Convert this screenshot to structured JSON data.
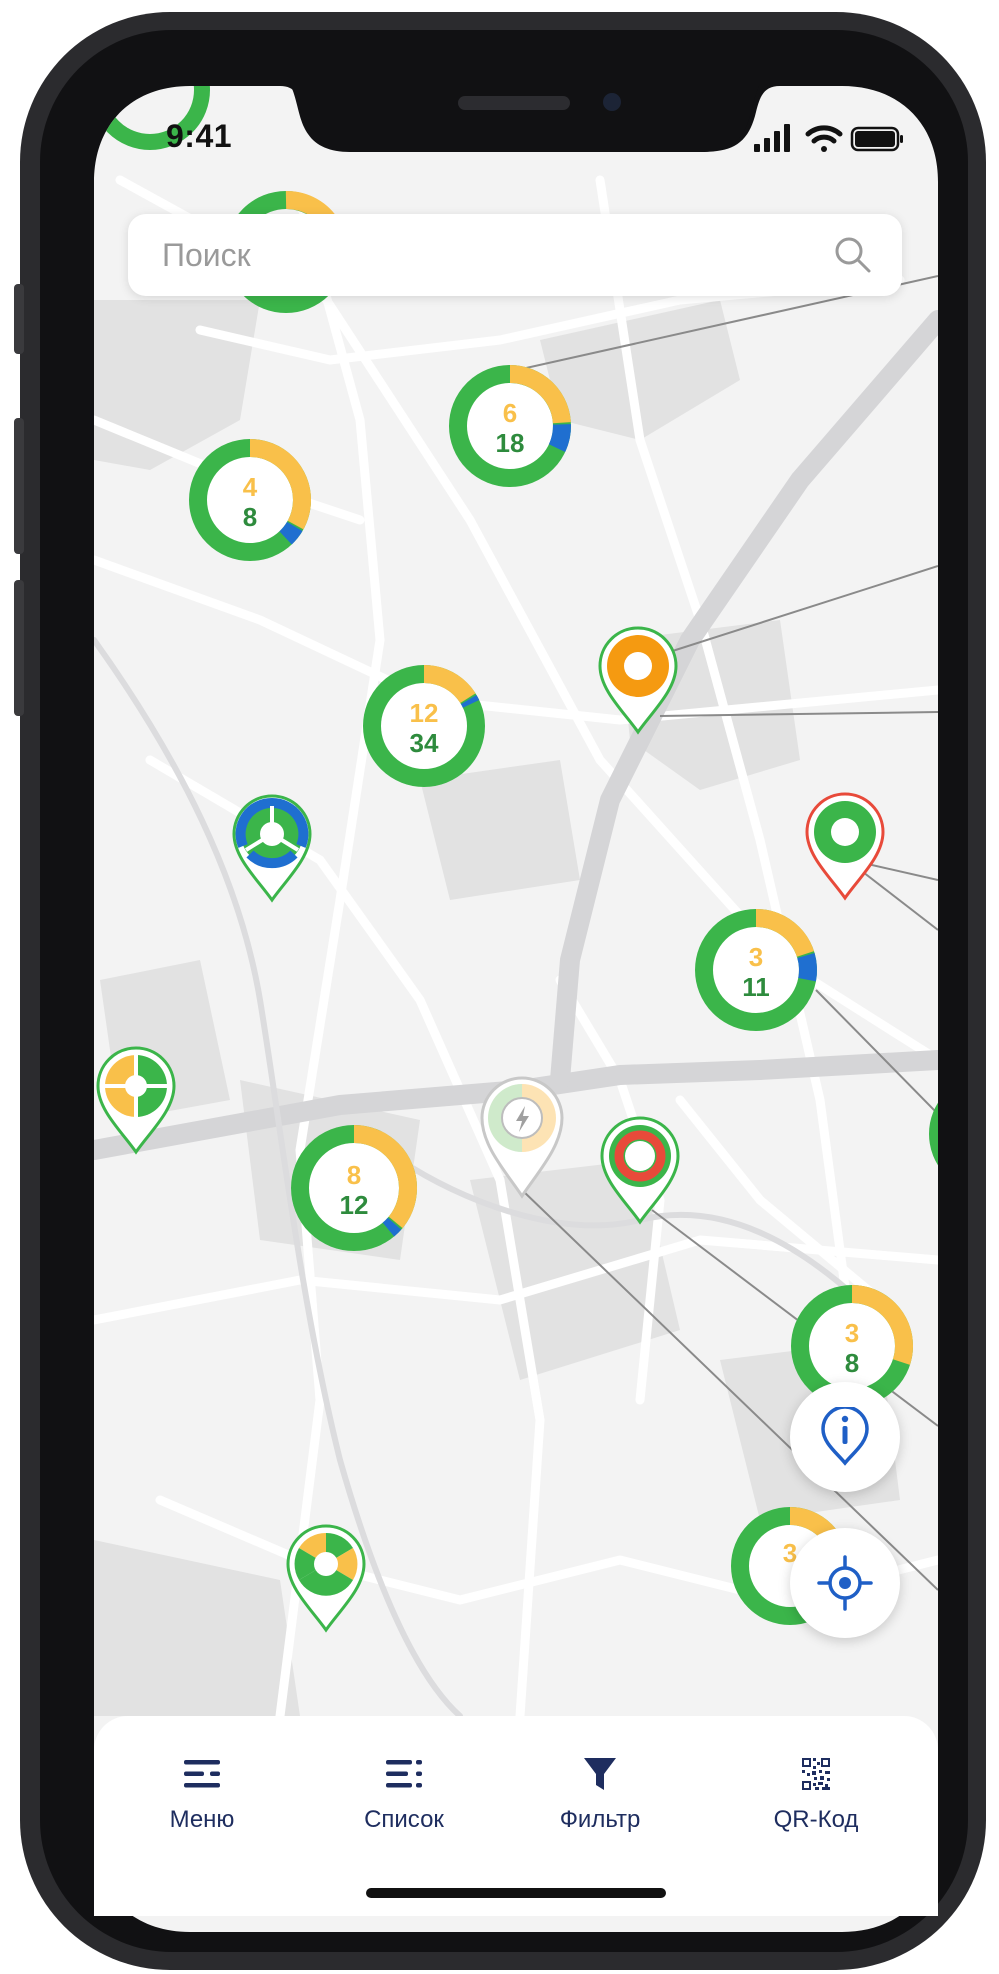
{
  "status_bar": {
    "time": "9:41"
  },
  "search": {
    "placeholder": "Поиск",
    "value": ""
  },
  "colors": {
    "available": "#3bb54a",
    "busy": "#f9c04a",
    "charging": "#1f6fd0",
    "faulty": "#e84a3a",
    "accent": "#f59a11",
    "nav_text": "#1e2d5f"
  },
  "map": {
    "clusters": [
      {
        "top": "6",
        "bottom": "18",
        "busy": 0.24,
        "charging": 0.08
      },
      {
        "top": "4",
        "bottom": "8",
        "busy": 0.33,
        "charging": 0.05
      },
      {
        "top": "12",
        "bottom": "34",
        "busy": 0.16,
        "charging": 0.02
      },
      {
        "top": "3",
        "bottom": "11",
        "busy": 0.2,
        "charging": 0.08
      },
      {
        "top": "8",
        "bottom": "12",
        "busy": 0.36,
        "charging": 0.03
      },
      {
        "top": "3",
        "bottom": "8",
        "busy": 0.3,
        "charging": 0.0
      },
      {
        "top": "3",
        "bottom": "",
        "busy": 0.25,
        "charging": 0.0
      }
    ],
    "pins": [
      {
        "status": "orange",
        "border": "available",
        "icon": "busy-station-pin-icon"
      },
      {
        "status": "green",
        "border": "faulty",
        "icon": "available-station-pin-icon"
      },
      {
        "status": "split-green-blue",
        "border": "available",
        "icon": "charging-station-pin-icon"
      },
      {
        "status": "split-green-orange",
        "border": "available",
        "icon": "mixed-station-pin-icon"
      },
      {
        "status": "ring-red",
        "border": "available",
        "icon": "faulty-station-pin-icon"
      },
      {
        "status": "selected",
        "border": "grey",
        "icon": "lightning-pin-icon"
      },
      {
        "status": "split-green-orange",
        "border": "available",
        "icon": "mixed-station-pin-icon"
      }
    ]
  },
  "buttons": {
    "info": "info-icon",
    "locate": "locate-icon"
  },
  "nav": {
    "items": [
      {
        "label": "Меню",
        "icon": "menu-icon"
      },
      {
        "label": "Список",
        "icon": "list-icon"
      },
      {
        "label": "Фильтр",
        "icon": "filter-icon"
      },
      {
        "label": "QR-Код",
        "icon": "qr-code-icon"
      }
    ]
  }
}
